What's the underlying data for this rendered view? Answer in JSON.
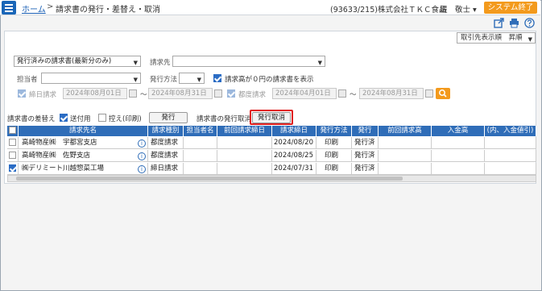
{
  "header": {
    "home": "ホーム",
    "separator": ">",
    "page_title": "請求書の発行・差替え・取消",
    "company": "(93633/215)株式会社ＴＫＣ食品",
    "user": "堤　敬士",
    "user_caret": "▾",
    "exit_label": "システム終了"
  },
  "icons": [
    "external-link-icon",
    "print-icon",
    "help-icon"
  ],
  "sort": {
    "value": "取引先表示順　昇順"
  },
  "filters": {
    "issue_type": "発行済みの請求書(最新分のみ)",
    "billing_label": "請求先",
    "billing_value": "",
    "staff_label": "担当者",
    "staff_value": "",
    "method_label": "発行方法",
    "method_value": "",
    "zero_label": "請求高が０円の請求書を表示",
    "cutoff_label": "締日請求",
    "cutoff_from": "2024年08月01日",
    "cutoff_to": "2024年08月31日",
    "tilde": "〜",
    "per_label": "都度請求",
    "per_from": "2024年04月01日",
    "per_to": "2024年08月31日"
  },
  "actions": {
    "replace_label": "請求書の差替え",
    "send_label": "送付用",
    "copy_label": "控え(印刷)",
    "issue_button": "発行",
    "cancel_label": "請求書の発行取消",
    "cancel_button": "発行取消"
  },
  "table": {
    "headers": [
      "請求先名",
      "請求種別",
      "担当者名",
      "前回請求締日",
      "請求締日",
      "発行方法",
      "発行",
      "前回請求高",
      "入金高",
      "(内、入金値引)"
    ],
    "rows": [
      {
        "checked": false,
        "name": "高崎物産㈱　宇都宮支店",
        "type": "都度請求",
        "staff": "",
        "prev_date": "",
        "date": "2024/08/20",
        "method": "印刷",
        "issued": "発行済"
      },
      {
        "checked": false,
        "name": "高崎物産㈱　佐野支店",
        "type": "都度請求",
        "staff": "",
        "prev_date": "",
        "date": "2024/08/25",
        "method": "印刷",
        "issued": "発行済"
      },
      {
        "checked": true,
        "name": "㈱デリミート川越惣菜工場",
        "type": "締日請求",
        "staff": "",
        "prev_date": "",
        "date": "2024/07/31",
        "method": "印刷",
        "issued": "発行済"
      }
    ]
  },
  "colors": {
    "accent": "#2f6db8",
    "exit": "#f39a1d",
    "highlight": "#e02020"
  }
}
